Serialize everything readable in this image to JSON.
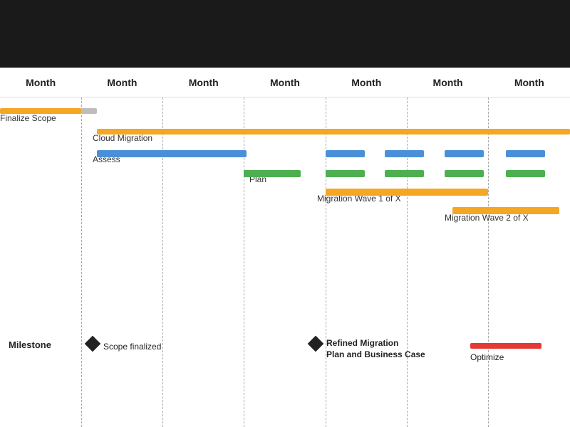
{
  "header": {
    "months": [
      "Month",
      "Month",
      "Month",
      "Month",
      "Month",
      "Month",
      "Month"
    ]
  },
  "rows": {
    "finalize_scope": "Finalize Scope",
    "cloud_migration": "Cloud Migration",
    "assess": "Assess",
    "plan": "Plan",
    "wave1": "Migration Wave 1 of X",
    "wave2": "Migration Wave 2 of X"
  },
  "milestones": {
    "label": "Milestone",
    "m1": "Scope finalized",
    "m2_line1": "Refined Migration",
    "m2_line2": "Plan and Business Case",
    "m3": "Optimize"
  },
  "colors": {
    "orange": "#f5a623",
    "blue": "#4a90d9",
    "green": "#4caf50",
    "red": "#e53935",
    "gray": "#bdbdbd",
    "black": "#222222"
  }
}
